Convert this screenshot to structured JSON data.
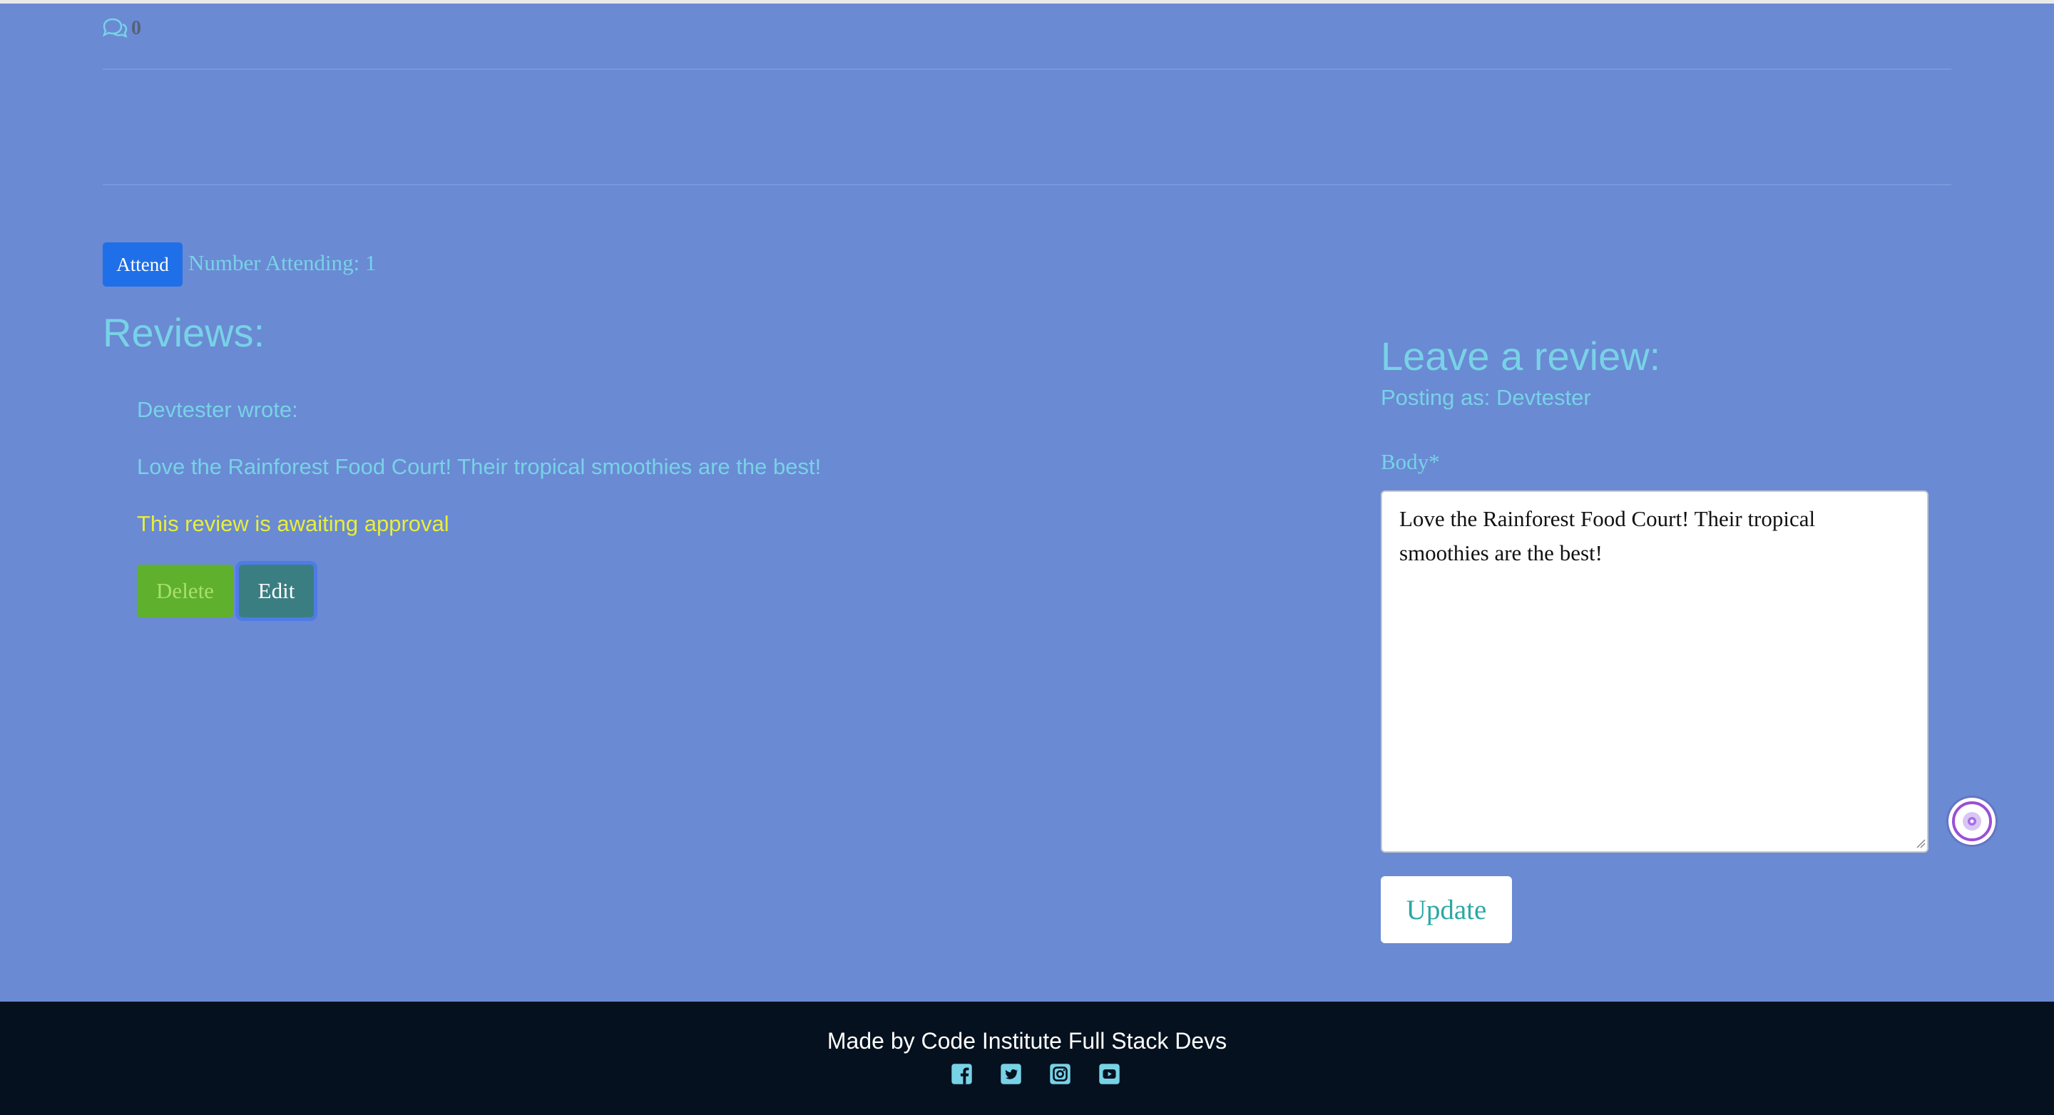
{
  "post": {
    "comment_count": "0",
    "attend_label": "Attend",
    "attending_text": "Number Attending: 1"
  },
  "reviews": {
    "heading": "Reviews:",
    "items": [
      {
        "author_line": "Devtester wrote:",
        "body": "Love the Rainforest Food Court! Their tropical smoothies are the best!",
        "status": "This review is awaiting approval",
        "delete_label": "Delete",
        "edit_label": "Edit"
      }
    ]
  },
  "review_form": {
    "heading": "Leave a review:",
    "posting_as": "Posting as: Devtester",
    "body_label": "Body*",
    "body_value": "Love the Rainforest Food Court! Their tropical smoothies are the best!",
    "submit_label": "Update"
  },
  "footer": {
    "text": "Made by Code Institute Full Stack Devs",
    "social_icons": [
      "facebook-icon",
      "twitter-icon",
      "instagram-icon",
      "youtube-icon"
    ]
  },
  "colors": {
    "page_background": "#6a8ad3",
    "accent_text": "#78d2e6",
    "status_text": "#e8ee3a",
    "attend_button": "#1f6fe8",
    "delete_button": "#5fb02d",
    "edit_button": "#3b7e82",
    "footer_background": "#06111f"
  }
}
